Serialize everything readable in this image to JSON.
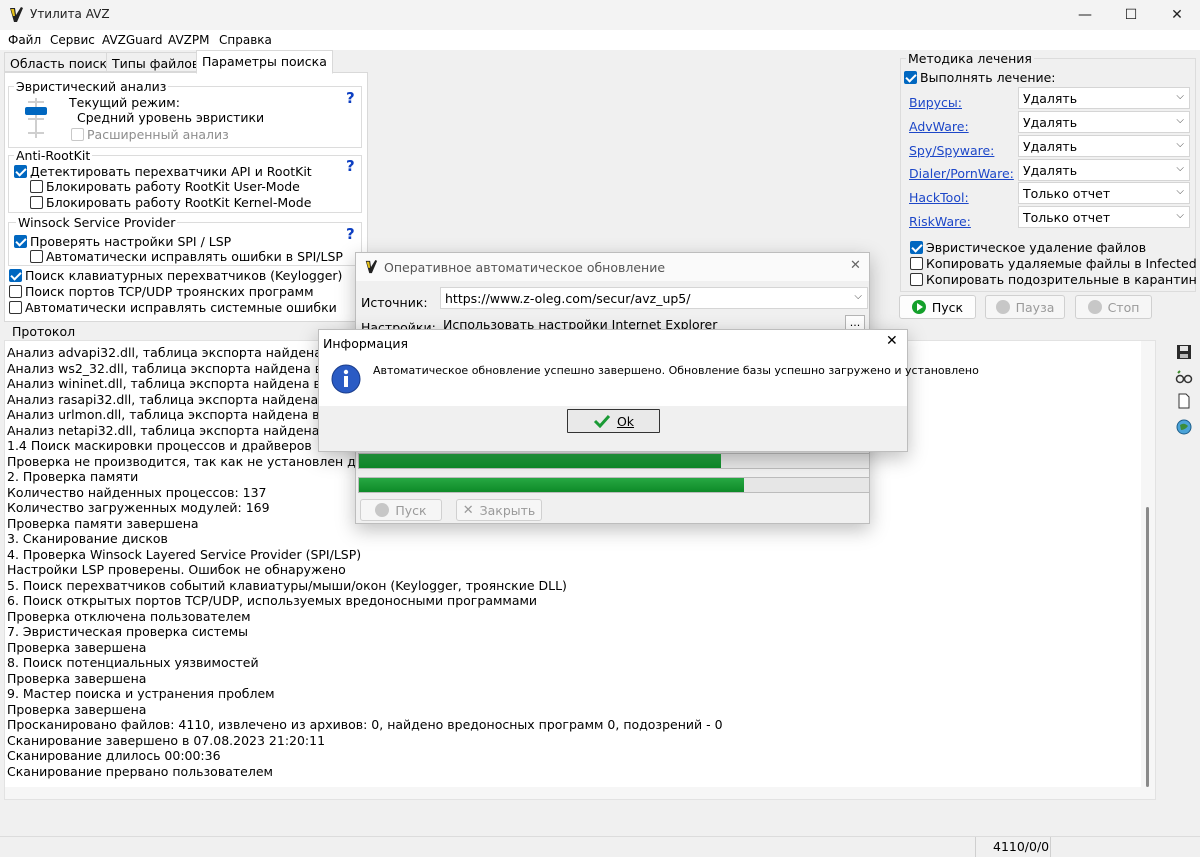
{
  "window": {
    "title": "Утилита AVZ",
    "minimize": "—",
    "maximize": "☐",
    "close": "✕"
  },
  "menu": [
    "Файл",
    "Сервис",
    "AVZGuard",
    "AVZPM",
    "Справка"
  ],
  "tabs": [
    "Область поиска",
    "Типы файлов",
    "Параметры поиска"
  ],
  "heuristic": {
    "title": "Эвристический анализ",
    "mode_label": "Текущий режим:",
    "mode_value": "Средний уровень эвристики",
    "extended": "Расширенный анализ",
    "help": "?"
  },
  "antirootkit": {
    "title": "Anti-RootKit",
    "detect": "Детектировать перехватчики API и RootKit",
    "block_user": "Блокировать работу RootKit User-Mode",
    "block_kernel": "Блокировать работу RootKit Kernel-Mode",
    "help": "?"
  },
  "winsock": {
    "title": "Winsock  Service Provider",
    "check": "Проверять настройки SPI / LSP",
    "autofix": "Автоматически исправлять ошибки в SPI/LSP",
    "help": "?"
  },
  "options": {
    "keylogger": "Поиск клавиатурных перехватчиков (Keylogger)",
    "ports": "Поиск портов TCP/UDP троянских программ",
    "autofix_system": "Автоматически исправлять системные ошибки"
  },
  "treatment": {
    "title": "Методика лечения",
    "perform": "Выполнять лечение:",
    "rows": [
      {
        "label": "Вирусы:",
        "value": "Удалять"
      },
      {
        "label": "AdvWare:",
        "value": "Удалять"
      },
      {
        "label": "Spy/Spyware:",
        "value": "Удалять"
      },
      {
        "label": "Dialer/PornWare:",
        "value": "Удалять"
      },
      {
        "label": "HackTool:",
        "value": "Только отчет"
      },
      {
        "label": "RiskWare:",
        "value": "Только отчет"
      }
    ],
    "heuristic_delete": "Эвристическое удаление файлов",
    "copy_deleted": "Копировать удаляемые файлы в  Infected",
    "copy_suspicious": "Копировать подозрительные в  карантин"
  },
  "actions": {
    "start": "Пуск",
    "pause": "Пауза",
    "stop": "Стоп"
  },
  "protocol": {
    "title": "Протокол",
    "lines": [
      " Анализ advapi32.dll, таблица экспорта найдена в секции",
      " Анализ ws2_32.dll, таблица экспорта найдена в секции",
      " Анализ wininet.dll, таблица экспорта найдена в секции",
      " Анализ rasapi32.dll, таблица экспорта найдена в секции",
      " Анализ urlmon.dll, таблица экспорта найдена в секции",
      " Анализ netapi32.dll, таблица экспорта найдена в секции",
      "1.4 Поиск маскировки процессов и драйверов",
      " Проверка не производится, так как не установлен драйвер",
      "2. Проверка памяти",
      " Количество найденных процессов: 137",
      " Количество загруженных модулей: 169",
      "Проверка памяти завершена",
      "3. Сканирование дисков",
      "4. Проверка Winsock Layered Service Provider (SPI/LSP)",
      " Настройки LSP проверены. Ошибок не обнаружено",
      "5. Поиск перехватчиков событий клавиатуры/мыши/окон (Keylogger, троянские DLL)",
      "6. Поиск открытых портов TCP/UDP, используемых вредоносными программами",
      " Проверка отключена пользователем",
      "7. Эвристическая проверка системы",
      "Проверка завершена",
      "8. Поиск потенциальных уязвимостей",
      "Проверка завершена",
      "9. Мастер поиска и устранения проблем",
      "Проверка завершена",
      "Просканировано файлов: 4110, извлечено из архивов: 0, найдено вредоносных программ 0, подозрений - 0",
      "Сканирование завершено в 07.08.2023 21:20:11",
      "Сканирование длилось 00:00:36",
      "Сканирование прервано пользователем"
    ]
  },
  "status": {
    "counter": "4110/0/0"
  },
  "update_dialog": {
    "title": "Оперативное автоматическое обновление",
    "source_label": "Источник:",
    "source_value": "https://www.z-oleg.com/secur/avz_up5/",
    "settings_label": "Настройки:",
    "settings_value": "Использовать настройки Internet Explorer",
    "browse": "...",
    "progress1": 0.71,
    "progress2": 0.755,
    "start": "Пуск",
    "close": "Закрыть"
  },
  "info_dialog": {
    "title": "Информация",
    "message": "Автоматическое обновление успешно завершено. Обновление базы успешно загружено и установлено",
    "ok": "Ok"
  },
  "colors": {
    "accent": "#0067c0",
    "link": "#1d47c8",
    "progress": "#1a9a35",
    "help": "#0d3fc2"
  }
}
